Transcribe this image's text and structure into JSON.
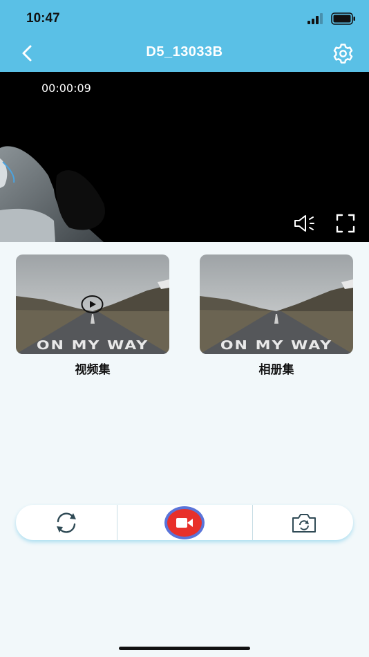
{
  "status_bar": {
    "time": "10:47"
  },
  "header": {
    "title": "D5_13033B"
  },
  "video": {
    "timestamp": "00:00:09"
  },
  "gallery": [
    {
      "label": "视频集",
      "has_play_icon": true,
      "thumbnail_text": "ON MY WAY"
    },
    {
      "label": "相册集",
      "has_play_icon": false,
      "thumbnail_text": "ON MY WAY"
    }
  ],
  "toolbar": {
    "icons": [
      "rotate-icon",
      "video-record-icon",
      "camera-switch-icon"
    ]
  },
  "colors": {
    "header": "#5ac0e6",
    "background": "#f2f8fa",
    "record": "#e8302a",
    "record_ring": "#5a74d9"
  }
}
